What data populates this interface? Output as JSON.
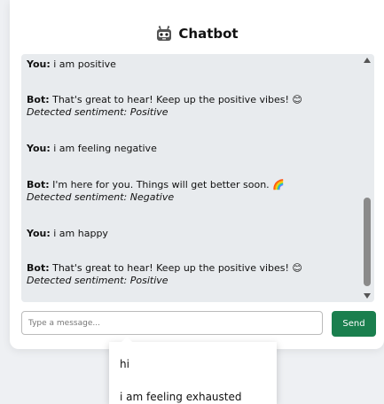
{
  "header": {
    "title": "Chatbot",
    "icon": "robot-icon"
  },
  "messages": [
    {
      "speaker": "You:",
      "text": "i am positive"
    },
    {
      "speaker": "Bot:",
      "text": "That's great to hear! Keep up the positive vibes! 😊",
      "sentiment": "Detected sentiment: Positive"
    },
    {
      "speaker": "You:",
      "text": "i am feeling negative"
    },
    {
      "speaker": "Bot:",
      "text": "I'm here for you. Things will get better soon. 🌈",
      "sentiment": "Detected sentiment: Negative"
    },
    {
      "speaker": "You:",
      "text": "i am happy"
    },
    {
      "speaker": "Bot:",
      "text": "That's great to hear! Keep up the positive vibes! 😊",
      "sentiment": "Detected sentiment: Positive"
    }
  ],
  "input": {
    "placeholder": "Type a message..."
  },
  "send_label": "Send",
  "suggestions": [
    "hi",
    "i am feeling exhausted"
  ],
  "colors": {
    "send": "#1a7f4e",
    "chat_bg": "#e8ebee"
  }
}
